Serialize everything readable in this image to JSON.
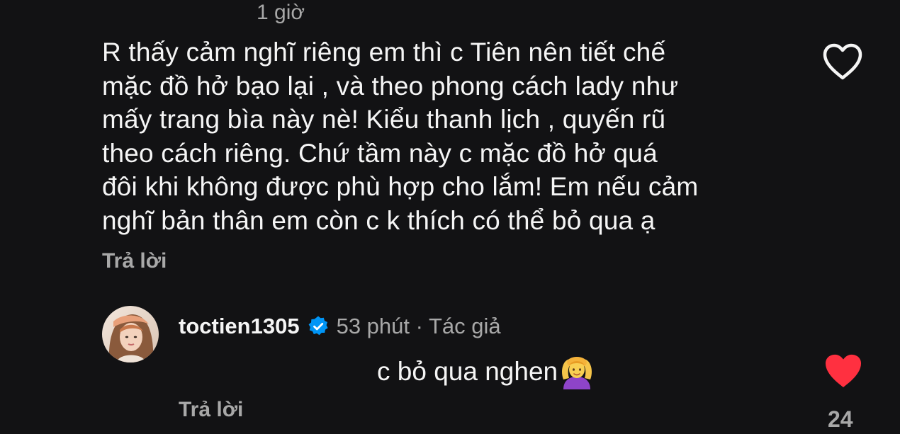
{
  "parent_comment": {
    "time": "1 giờ",
    "lines": [
      "R thấy cảm nghĩ riêng em thì c Tiên nên tiết chế",
      "mặc đồ hở bạo lại , và theo phong cách lady như",
      "mấy trang bìa này nè! Kiểu thanh lịch , quyến rũ",
      "theo cách riêng. Chứ tầm này c mặc đồ hở quá",
      "đôi khi không được phù hợp cho lắm! Em nếu cảm",
      "nghĩ bản thân em còn c k thích có thể bỏ qua ạ"
    ],
    "reply_label": "Trả lời",
    "like_icon": "heart-outline-icon"
  },
  "reply_comment": {
    "username": "toctien1305",
    "verified_icon": "verified-badge-icon",
    "meta": "53 phút · Tác giả",
    "text": "c bỏ qua nghen",
    "emoji_icon": "person-gesturing-ok-emoji",
    "reply_label": "Trả lời",
    "like_icon": "heart-filled-icon",
    "like_count": "24"
  },
  "colors": {
    "background": "#121214",
    "text_primary": "#f5f5f5",
    "text_secondary": "#a8a8a8",
    "like_red": "#ff3040",
    "verified_blue": "#0095f6"
  }
}
